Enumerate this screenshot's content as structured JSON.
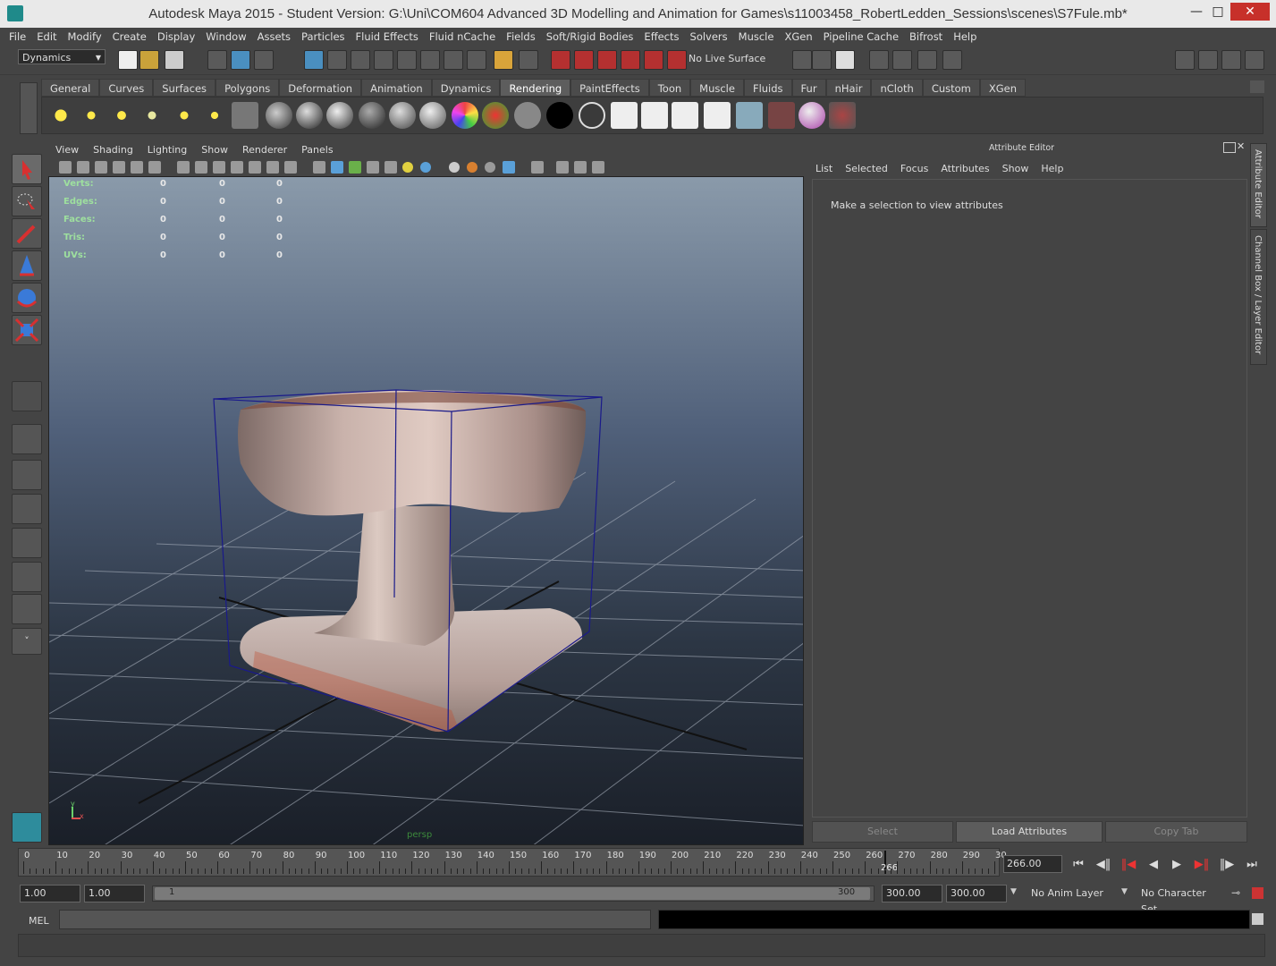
{
  "window": {
    "title": "Autodesk Maya 2015 - Student Version: G:\\Uni\\COM604 Advanced 3D Modelling and Animation for Games\\s11003458_RobertLedden_Sessions\\scenes\\S7Fule.mb*"
  },
  "menus": [
    "File",
    "Edit",
    "Modify",
    "Create",
    "Display",
    "Window",
    "Assets",
    "Particles",
    "Fluid Effects",
    "Fluid nCache",
    "Fields",
    "Soft/Rigid Bodies",
    "Effects",
    "Solvers",
    "Muscle",
    "XGen",
    "Pipeline Cache",
    "Bifrost",
    "Help"
  ],
  "status_line": {
    "mode": "Dynamics",
    "live_surface": "No Live Surface"
  },
  "shelf_tabs": [
    "General",
    "Curves",
    "Surfaces",
    "Polygons",
    "Deformation",
    "Animation",
    "Dynamics",
    "Rendering",
    "PaintEffects",
    "Toon",
    "Muscle",
    "Fluids",
    "Fur",
    "nHair",
    "nCloth",
    "Custom",
    "XGen"
  ],
  "active_shelf_tab": "Rendering",
  "viewport": {
    "menus": [
      "View",
      "Shading",
      "Lighting",
      "Show",
      "Renderer",
      "Panels"
    ],
    "hud_rows": [
      {
        "label": "Verts:",
        "values": [
          "0",
          "0",
          "0"
        ]
      },
      {
        "label": "Edges:",
        "values": [
          "0",
          "0",
          "0"
        ]
      },
      {
        "label": "Faces:",
        "values": [
          "0",
          "0",
          "0"
        ]
      },
      {
        "label": "Tris:",
        "values": [
          "0",
          "0",
          "0"
        ]
      },
      {
        "label": "UVs:",
        "values": [
          "0",
          "0",
          "0"
        ]
      }
    ],
    "camera_label": "persp",
    "axis_y": "y",
    "axis_x": "x"
  },
  "attribute_editor": {
    "title": "Attribute Editor",
    "menus": [
      "List",
      "Selected",
      "Focus",
      "Attributes",
      "Show",
      "Help"
    ],
    "message": "Make a selection to view attributes",
    "buttons": {
      "select": "Select",
      "load": "Load Attributes",
      "copy": "Copy Tab"
    }
  },
  "side_tabs": {
    "attribute_editor": "Attribute Editor",
    "channel_box": "Channel Box / Layer Editor"
  },
  "time_slider": {
    "ticks": [
      "0",
      "10",
      "20",
      "30",
      "40",
      "50",
      "60",
      "70",
      "80",
      "90",
      "100",
      "110",
      "120",
      "130",
      "140",
      "150",
      "160",
      "170",
      "180",
      "190",
      "200",
      "210",
      "220",
      "230",
      "240",
      "250",
      "260",
      "270",
      "280",
      "290",
      "30"
    ],
    "current_frame": "266",
    "current_time": "266.00"
  },
  "range_slider": {
    "start_time": "1.00",
    "playback_start": "1.00",
    "range_start": "1",
    "range_end": "300",
    "playback_end": "300.00",
    "end_time": "300.00",
    "anim_layer": "No Anim Layer",
    "character_set": "No Character Set"
  },
  "command_line": {
    "label": "MEL"
  },
  "colors": {
    "accent_tab": "#5d5d5d",
    "bbox": "#1a1a8a",
    "close": "#c7302a"
  }
}
